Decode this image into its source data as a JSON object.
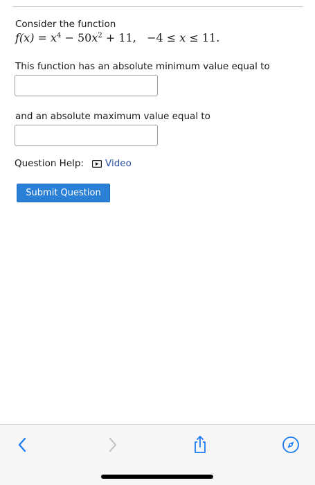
{
  "question": {
    "intro": "Consider the function",
    "formula": {
      "lhs": "f(x)",
      "eq": " = ",
      "t1_var": "x",
      "t1_exp": "4",
      "minus": " − 50",
      "t2_var": "x",
      "t2_exp": "2",
      "plus": " + 11,",
      "domain_left": "−4 ≤ ",
      "domain_var": "x",
      "domain_right": " ≤ 11."
    },
    "min_prompt": "This function has an absolute minimum value equal to",
    "max_prompt": "and an absolute maximum value equal to",
    "min_value": "",
    "max_value": ""
  },
  "help": {
    "label": "Question Help:",
    "video_label": "Video"
  },
  "submit_label": "Submit Question",
  "colors": {
    "accent": "#2a7fd6",
    "link": "#2a4ca0",
    "toolbar_icon": "#1a7cf5",
    "toolbar_disabled": "#c4c4c4"
  },
  "icons": {
    "back": "chevron-left-icon",
    "forward": "chevron-right-icon",
    "share": "share-icon",
    "safari": "compass-icon",
    "video": "play-box-icon"
  }
}
